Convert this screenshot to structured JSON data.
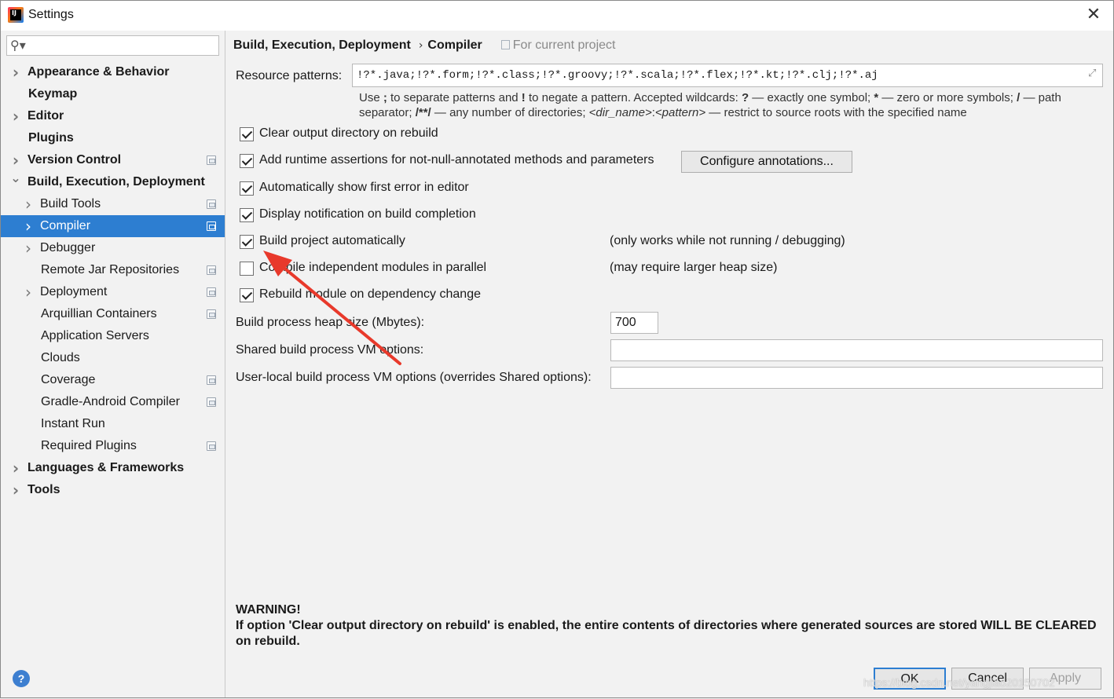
{
  "window": {
    "title": "Settings",
    "app_icon_letters": "IJ"
  },
  "search": {
    "placeholder": ""
  },
  "sidebar": {
    "items": [
      {
        "label": "Appearance & Behavior",
        "bold": true,
        "chevron": "right",
        "indent": 0,
        "project": false
      },
      {
        "label": "Keymap",
        "bold": true,
        "chevron": "none",
        "indent": 0,
        "project": false
      },
      {
        "label": "Editor",
        "bold": true,
        "chevron": "right",
        "indent": 0,
        "project": false
      },
      {
        "label": "Plugins",
        "bold": true,
        "chevron": "none",
        "indent": 0,
        "project": false
      },
      {
        "label": "Version Control",
        "bold": true,
        "chevron": "right",
        "indent": 0,
        "project": true
      },
      {
        "label": "Build, Execution, Deployment",
        "bold": true,
        "chevron": "down",
        "indent": 0,
        "project": false
      },
      {
        "label": "Build Tools",
        "bold": false,
        "chevron": "right",
        "indent": 1,
        "project": true
      },
      {
        "label": "Compiler",
        "bold": false,
        "chevron": "right",
        "indent": 1,
        "project": true,
        "selected": true
      },
      {
        "label": "Debugger",
        "bold": false,
        "chevron": "right",
        "indent": 1,
        "project": false
      },
      {
        "label": "Remote Jar Repositories",
        "bold": false,
        "chevron": "none",
        "indent": 1,
        "project": true
      },
      {
        "label": "Deployment",
        "bold": false,
        "chevron": "right",
        "indent": 1,
        "project": true
      },
      {
        "label": "Arquillian Containers",
        "bold": false,
        "chevron": "none",
        "indent": 1,
        "project": true
      },
      {
        "label": "Application Servers",
        "bold": false,
        "chevron": "none",
        "indent": 1,
        "project": false
      },
      {
        "label": "Clouds",
        "bold": false,
        "chevron": "none",
        "indent": 1,
        "project": false
      },
      {
        "label": "Coverage",
        "bold": false,
        "chevron": "none",
        "indent": 1,
        "project": true
      },
      {
        "label": "Gradle-Android Compiler",
        "bold": false,
        "chevron": "none",
        "indent": 1,
        "project": true
      },
      {
        "label": "Instant Run",
        "bold": false,
        "chevron": "none",
        "indent": 1,
        "project": false
      },
      {
        "label": "Required Plugins",
        "bold": false,
        "chevron": "none",
        "indent": 1,
        "project": true
      },
      {
        "label": "Languages & Frameworks",
        "bold": true,
        "chevron": "right",
        "indent": 0,
        "project": false
      },
      {
        "label": "Tools",
        "bold": true,
        "chevron": "right",
        "indent": 0,
        "project": false
      }
    ]
  },
  "breadcrumb": {
    "parent": "Build, Execution, Deployment",
    "current": "Compiler",
    "scope": "For current project"
  },
  "resource": {
    "label": "Resource patterns:",
    "value": "!?*.java;!?*.form;!?*.class;!?*.groovy;!?*.scala;!?*.flex;!?*.kt;!?*.clj;!?*.aj"
  },
  "hint": {
    "line1_a": "Use ",
    "semi": ";",
    "line1_b": " to separate patterns and ",
    "bang": "!",
    "line1_c": " to negate a pattern. Accepted wildcards: ",
    "q": "?",
    "line1_d": " — exactly one symbol; ",
    "star": "*",
    "line1_e": " — zero or more symbols; ",
    "slash": "/",
    "line1_f": " — path",
    "line2_a": "separator; ",
    "dstar": "/**/",
    "line2_b": " — any number of directories; ",
    "dir": "<dir_name>",
    "colon": ":",
    "pat": "<pattern>",
    "line2_c": " — restrict to source roots with the specified name"
  },
  "options": [
    {
      "label": "Clear output directory on rebuild",
      "checked": true
    },
    {
      "label": "Add runtime assertions for not-null-annotated methods and parameters",
      "checked": true
    },
    {
      "label": "Automatically show first error in editor",
      "checked": true
    },
    {
      "label": "Display notification on build completion",
      "checked": true
    },
    {
      "label": "Build project automatically",
      "checked": true,
      "note": "(only works while not running / debugging)"
    },
    {
      "label": "Compile independent modules in parallel",
      "checked": false,
      "note": "(may require larger heap size)"
    },
    {
      "label": "Rebuild module on dependency change",
      "checked": true
    }
  ],
  "configure_annotations_label": "Configure annotations...",
  "heap": {
    "label": "Build process heap size (Mbytes):",
    "value": "700"
  },
  "shared_vm": {
    "label": "Shared build process VM options:",
    "value": ""
  },
  "user_vm": {
    "label": "User-local build process VM options (overrides Shared options):",
    "value": ""
  },
  "warning": {
    "title": "WARNING!",
    "body": "If option 'Clear output directory on rebuild' is enabled, the entire contents of directories where generated sources are stored WILL BE CLEARED on rebuild."
  },
  "footer": {
    "ok": "OK",
    "cancel": "Cancel",
    "apply": "Apply",
    "help": "?"
  },
  "watermark": "https://blog.csdn.net/yangjiao20150702"
}
